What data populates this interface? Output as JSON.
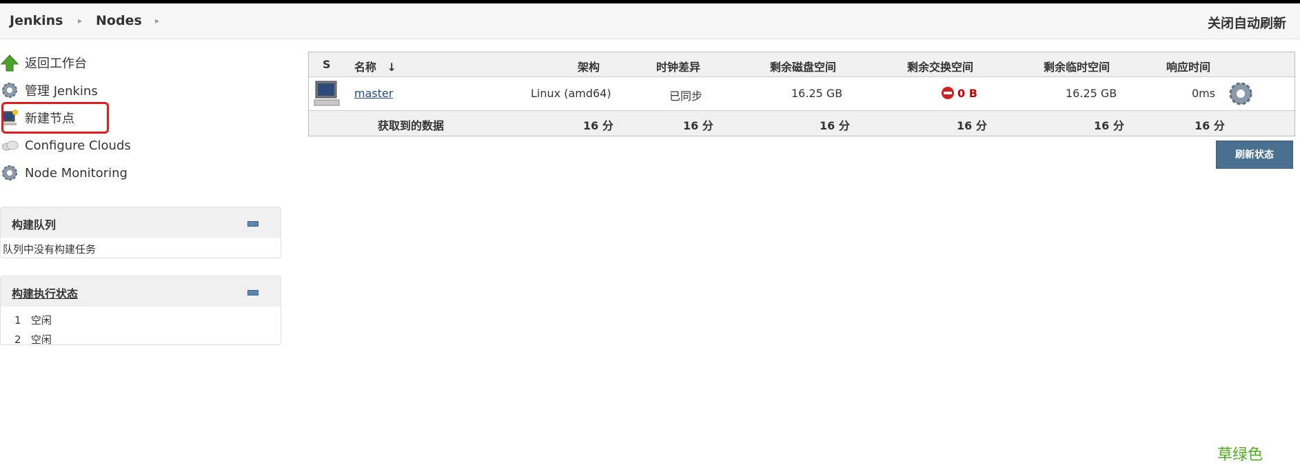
{
  "breadcrumb": {
    "items": [
      "Jenkins",
      "Nodes"
    ]
  },
  "header": {
    "auto_refresh": "关闭自动刷新"
  },
  "sidebar": {
    "tasks": [
      {
        "label": "返回工作台",
        "icon": "up-arrow-icon"
      },
      {
        "label": "管理 Jenkins",
        "icon": "gear-icon"
      },
      {
        "label": "新建节点",
        "icon": "computer-new-icon"
      },
      {
        "label": "Configure Clouds",
        "icon": "cloud-icon"
      },
      {
        "label": "Node Monitoring",
        "icon": "gear-icon"
      }
    ]
  },
  "build_queue": {
    "title": "构建队列",
    "empty_text": "队列中没有构建任务"
  },
  "executor_status": {
    "title": "构建执行状态",
    "executors": [
      {
        "number": "1",
        "state": "空闲"
      },
      {
        "number": "2",
        "state": "空闲"
      }
    ]
  },
  "nodes_table": {
    "headers": {
      "s": "S",
      "name": "名称",
      "sort_arrow": "↓",
      "arch": "架构",
      "clock": "时钟差异",
      "disk": "剩余磁盘空间",
      "swap": "剩余交换空间",
      "temp": "剩余临时空间",
      "response": "响应时间"
    },
    "rows": [
      {
        "name": "master",
        "arch": "Linux (amd64)",
        "clock": "已同步",
        "disk": "16.25 GB",
        "swap": "0 B",
        "temp": "16.25 GB",
        "response": "0ms"
      }
    ],
    "summary": {
      "label": "获取到的数据",
      "arch": "16 分",
      "clock": "16 分",
      "disk": "16 分",
      "swap": "16 分",
      "temp": "16 分",
      "response": "16 分"
    }
  },
  "refresh_button": "刷新状态",
  "annotation": "草绿色",
  "colors": {
    "highlight_border": "#e31b1b",
    "button_bg": "#4a7090",
    "annotation": "#4caf1a",
    "error": "#cc0000"
  }
}
